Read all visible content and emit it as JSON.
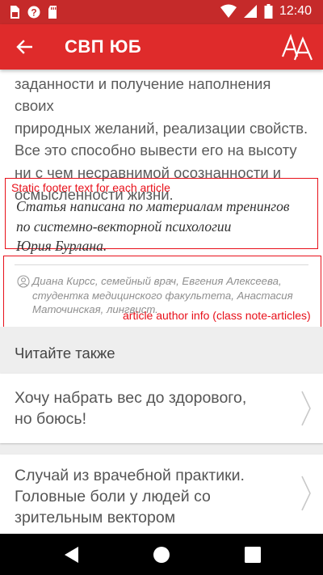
{
  "status_bar": {
    "time": "12:40",
    "icons": [
      "sim-card-icon",
      "wifi-icon",
      "sd-card-icon",
      "signal-icon",
      "battery-icon"
    ]
  },
  "app_bar": {
    "title": "СВП ЮБ",
    "back_icon": "arrow-left-icon",
    "font_size_icon": "font-size-icon"
  },
  "article": {
    "body_lines": [
      "заданности и получение наполнения своих",
      "природных желаний, реализации свойств.",
      "Все это способно вывести его на высоту",
      "ни с чем несравнимой осознанности и",
      "осмысленности жизни."
    ],
    "footer_lines": [
      "Статья написана по материалам тренингов",
      "по системно-векторной психологии",
      "Юрия Бурлана."
    ],
    "author_lines": [
      "Диана Кирсс, семейный врач, Евгения Алексеева,",
      "студентка медицинского факультета, Анастасия",
      "Маточинская, лингвист."
    ]
  },
  "annotations": {
    "footer_label": "Static footer text for each article",
    "author_label": "article author info (class note-articles)",
    "color": "#e8101a"
  },
  "read_also": {
    "title": "Читайте также",
    "items": [
      {
        "lines": [
          "Хочу набрать вес до здорового,",
          "но боюсь!"
        ]
      },
      {
        "lines": [
          "Случай из врачебной практики.",
          "Головные боли у людей со",
          "зрительным вектором"
        ]
      }
    ]
  },
  "colors": {
    "status_bar": "#c52a2a",
    "app_bar": "#df2b2b",
    "section_bg": "#eeeeee"
  }
}
